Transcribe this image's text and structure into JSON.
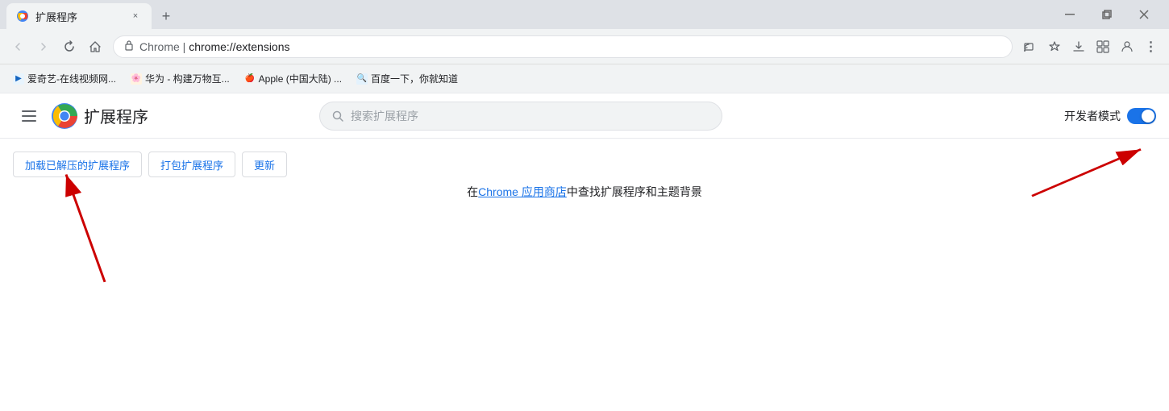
{
  "browser": {
    "tab": {
      "favicon": "🧩",
      "label": "扩展程序",
      "close_icon": "×"
    },
    "new_tab_icon": "+",
    "window_controls": {
      "minimize": "─",
      "maximize": "□",
      "close": "×",
      "restore": "❐"
    },
    "address_bar": {
      "secure_icon": "🔒",
      "chrome_prefix": "Chrome",
      "separator": " | ",
      "url": "chrome://extensions"
    },
    "toolbar_icons": [
      "⬆",
      "★",
      "⬇",
      "⬜",
      "👤",
      "⋮"
    ]
  },
  "bookmarks": [
    {
      "icon": "📺",
      "label": "爱奇艺-在线视频网..."
    },
    {
      "icon": "🌸",
      "label": "华为 - 构建万物互..."
    },
    {
      "icon": "🍎",
      "label": "Apple (中国大陆) ..."
    },
    {
      "icon": "🔍",
      "label": "百度一下，你就知道"
    }
  ],
  "extensions_page": {
    "menu_icon": "☰",
    "title": "扩展程序",
    "search_placeholder": "搜索扩展程序",
    "dev_mode_label": "开发者模式",
    "action_buttons": [
      "加载已解压的扩展程序",
      "打包扩展程序",
      "更新"
    ],
    "empty_state": {
      "prefix": "在 ",
      "link_text": "Chrome 应用商店",
      "suffix": "中查找扩展程序和主题背景"
    }
  }
}
